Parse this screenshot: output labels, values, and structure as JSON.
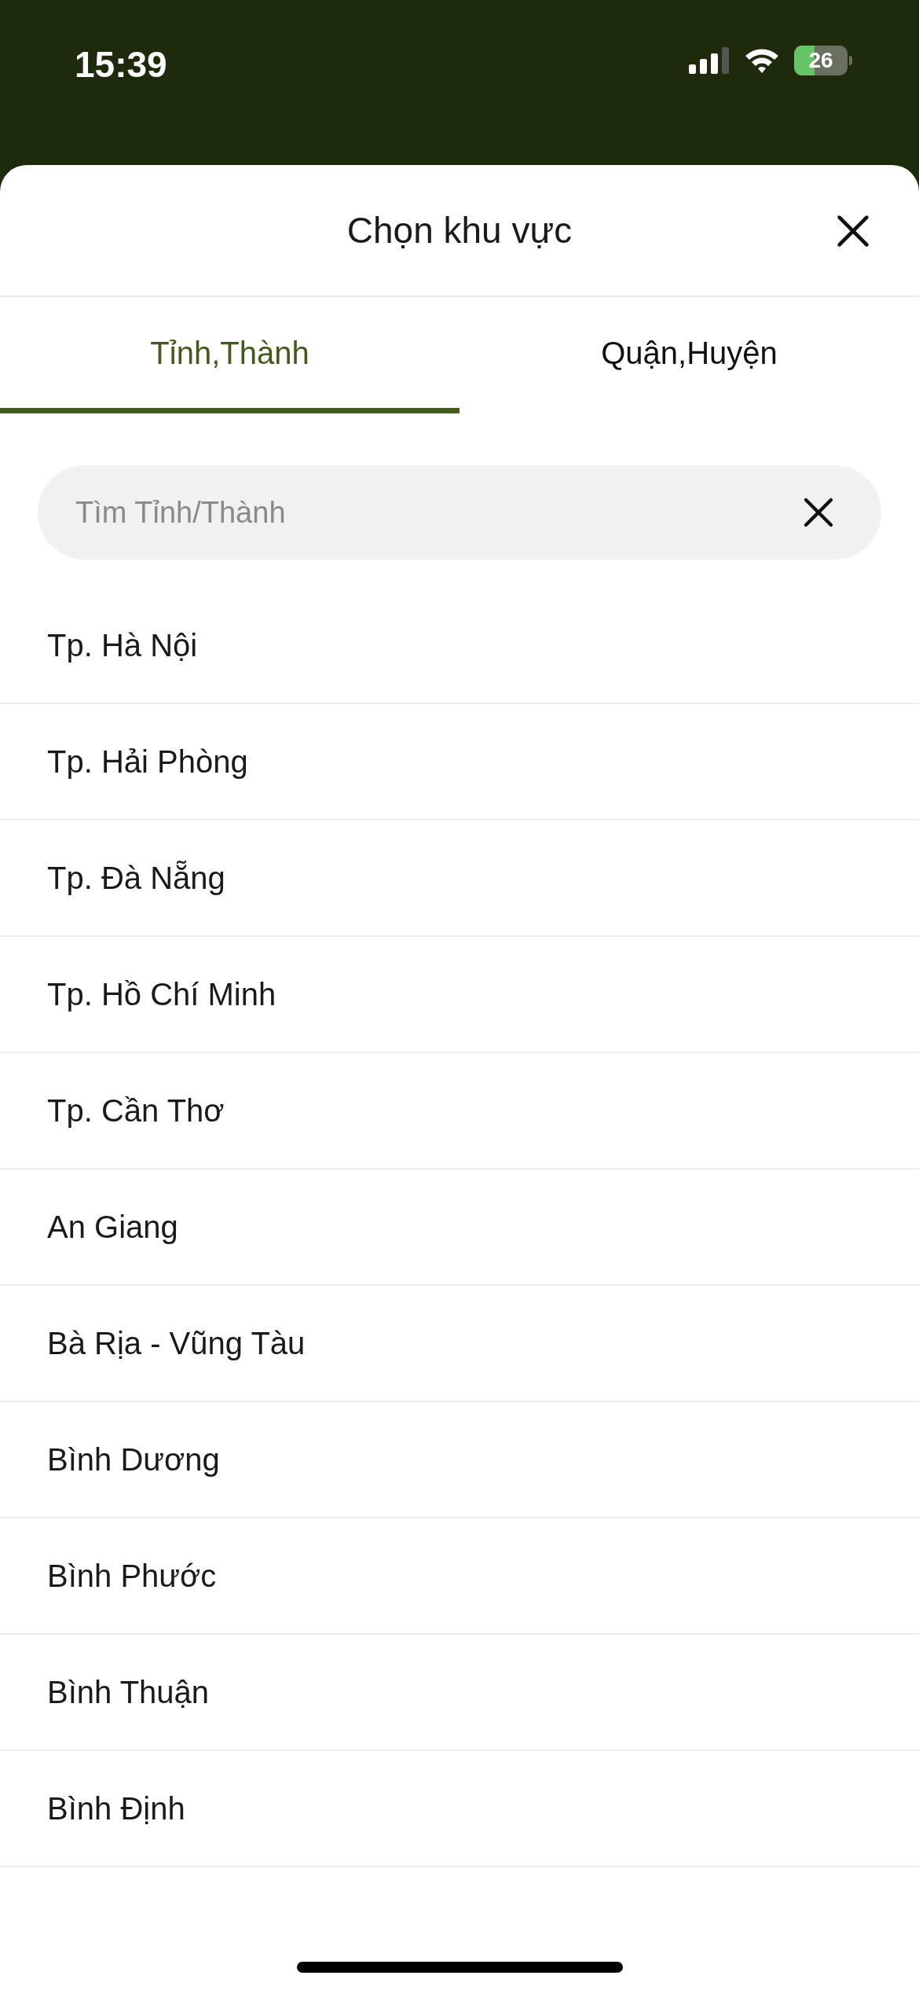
{
  "status_bar": {
    "time": "15:39",
    "battery": "26"
  },
  "sheet": {
    "title": "Chọn khu vực"
  },
  "tabs": [
    {
      "label": "Tỉnh,Thành",
      "selected": true
    },
    {
      "label": "Quận,Huyện",
      "selected": false
    }
  ],
  "search": {
    "placeholder": "Tìm Tỉnh/Thành"
  },
  "items": [
    "Tp. Hà Nội",
    "Tp. Hải Phòng",
    "Tp. Đà Nẵng",
    "Tp. Hồ Chí Minh",
    "Tp. Cần Thơ",
    "An Giang",
    "Bà Rịa - Vũng Tàu",
    "Bình Dương",
    "Bình Phước",
    "Bình Thuận",
    "Bình Định"
  ]
}
